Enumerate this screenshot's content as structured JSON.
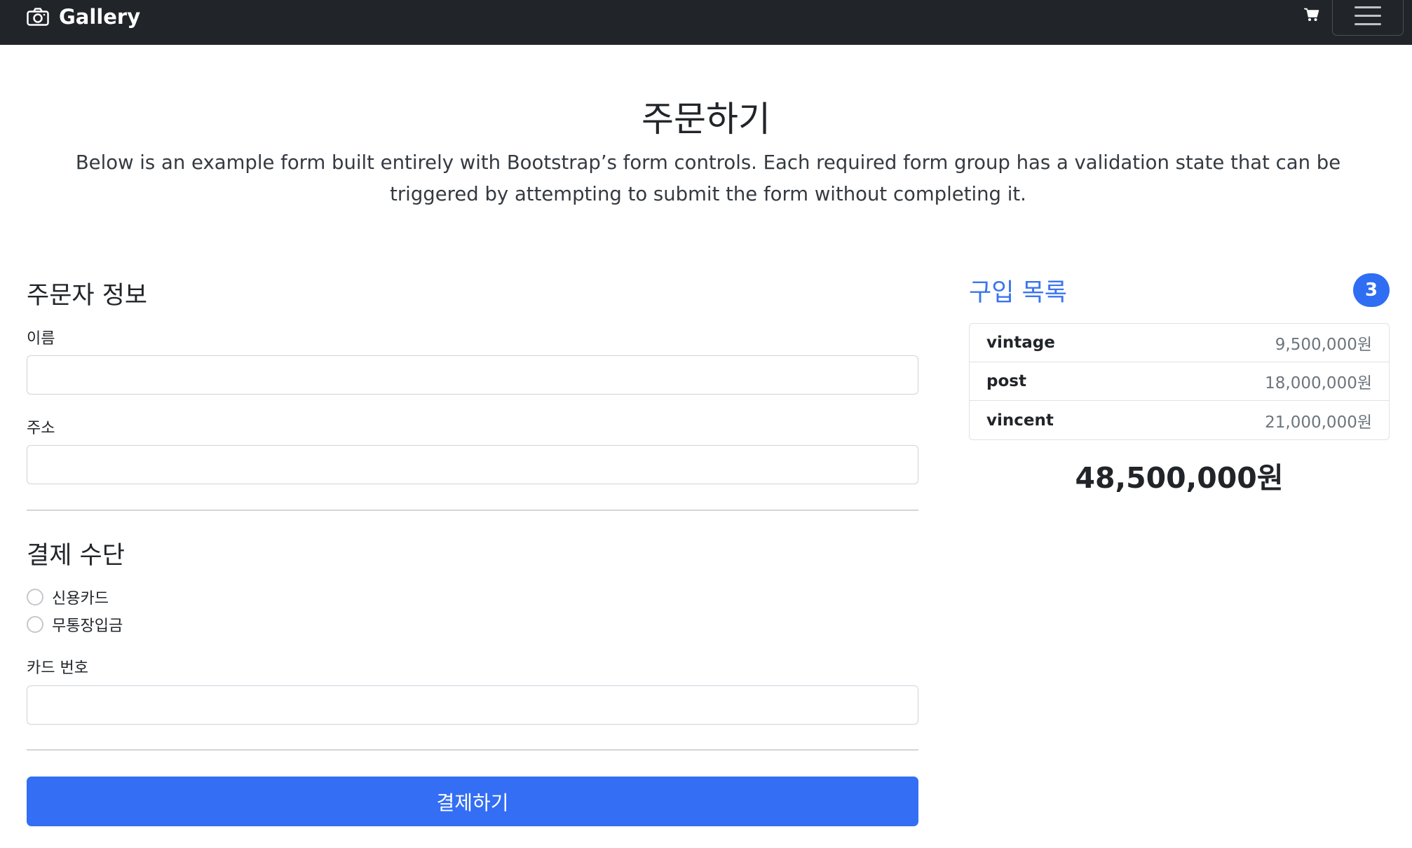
{
  "navbar": {
    "brand": "Gallery",
    "icons": {
      "brand": "camera-icon",
      "cart": "cart-icon",
      "menu": "hamburger-menu-icon"
    }
  },
  "hero": {
    "title": "주문하기",
    "lead": "Below is an example form built entirely with Bootstrap’s form controls. Each required form group has a validation state that can be triggered by attempting to submit the form without completing it."
  },
  "orderer": {
    "heading": "주문자 정보",
    "name_label": "이름",
    "name_value": "",
    "address_label": "주소",
    "address_value": ""
  },
  "payment": {
    "heading": "결제 수단",
    "options": [
      {
        "label": "신용카드",
        "checked": false
      },
      {
        "label": "무통장입금",
        "checked": false
      }
    ],
    "card_label": "카드 번호",
    "card_value": "",
    "submit_label": "결제하기"
  },
  "cart": {
    "title": "구입 목록",
    "count": "3",
    "items": [
      {
        "name": "vintage",
        "price": "9,500,000원"
      },
      {
        "name": "post",
        "price": "18,000,000원"
      },
      {
        "name": "vincent",
        "price": "21,000,000원"
      }
    ],
    "total": "48,500,000원"
  },
  "colors": {
    "navbar_bg": "#212529",
    "primary": "#336ef4",
    "cart_title": "#3a74f0"
  }
}
